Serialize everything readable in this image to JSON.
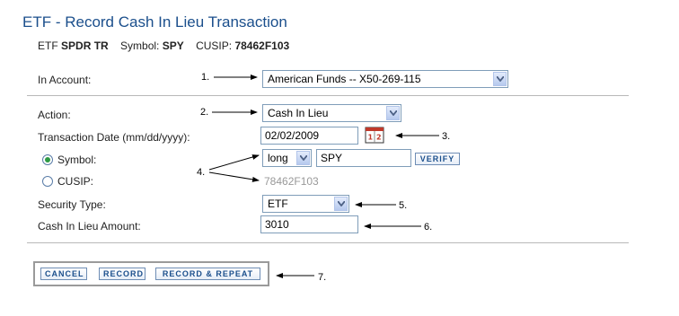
{
  "page": {
    "title": "ETF - Record Cash In Lieu Transaction",
    "subtitle": {
      "etf_label": "ETF",
      "etf_name": "SPDR TR",
      "symbol_label": "Symbol:",
      "symbol_value": "SPY",
      "cusip_label": "CUSIP:",
      "cusip_value": "78462F103"
    }
  },
  "form": {
    "account_label": "In Account:",
    "account_value": "American Funds -- X50-269-115",
    "action_label": "Action:",
    "action_value": "Cash In Lieu",
    "date_label": "Transaction Date (mm/dd/yyyy):",
    "date_value": "02/02/2009",
    "symbol_radio_label": "Symbol:",
    "symbol_position": "long",
    "symbol_input": "SPY",
    "verify_label": "VERIFY",
    "cusip_radio_label": "CUSIP:",
    "cusip_value": "78462F103",
    "security_type_label": "Security Type:",
    "security_type_value": "ETF",
    "amount_label": "Cash In Lieu Amount:",
    "amount_value": "3010",
    "selected_identifier": "symbol"
  },
  "buttons": {
    "cancel": "CANCEL",
    "record": "RECORD",
    "record_repeat": "RECORD & REPEAT"
  },
  "annotations": {
    "n1": "1.",
    "n2": "2.",
    "n3": "3.",
    "n4": "4.",
    "n5": "5.",
    "n6": "6.",
    "n7": "7."
  },
  "colors": {
    "title": "#1b4f8c",
    "field_border": "#7f9db9",
    "radio_selected": "#2e9a44"
  },
  "icons": {
    "calendar": "calendar-icon",
    "dropdown": "chevron-down-icon"
  }
}
